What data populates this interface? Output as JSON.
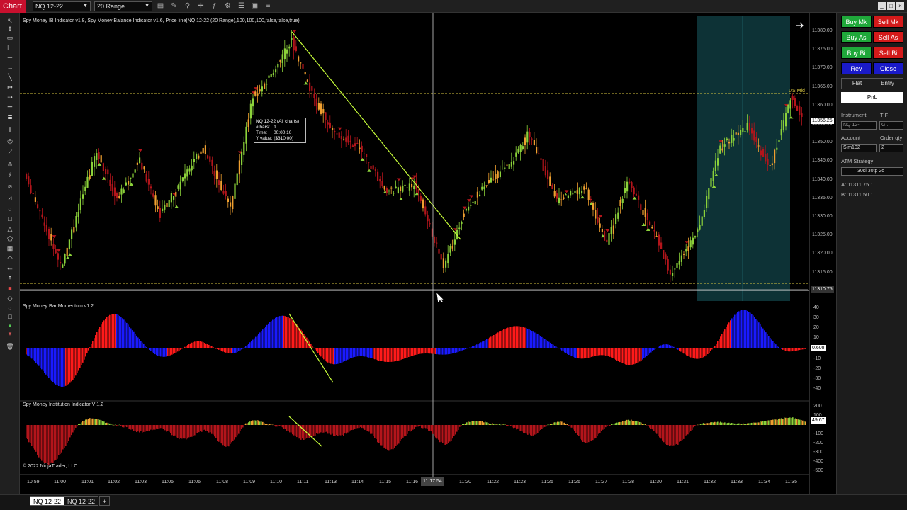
{
  "titlebar": {
    "chart_tab": "Chart",
    "instrument": "NQ 12-22",
    "bar_type": "20 Range"
  },
  "chart": {
    "price_pane_label": "Spy Money IB Indicator v1.8, Spy Money Balance Indicator v1.6, Price line(NQ 12-22 (20 Range),100,100,100,false,false,true)",
    "momentum_pane_label": "Spy Money Bar Momentum v1.2",
    "institution_pane_label": "Spy Money Institution Indicator V 1.2",
    "copyright": "© 2022 NinjaTrader, LLC",
    "us_mid_label": "US Mid",
    "price_axis": [
      "11380.00",
      "11375.00",
      "11370.00",
      "11365.00",
      "11360.00",
      "11355.00",
      "11350.00",
      "11345.00",
      "11340.00",
      "11335.00",
      "11330.00",
      "11325.00",
      "11320.00",
      "11315.00"
    ],
    "price_markers": {
      "current": "11356.25",
      "cursor": "11310.75"
    },
    "momentum_axis": [
      "40",
      "30",
      "20",
      "10",
      "-10",
      "-20",
      "-30",
      "-40"
    ],
    "momentum_marker": "0.608",
    "institution_axis": [
      "200",
      "100",
      "-100",
      "-200",
      "-300",
      "-400",
      "-500"
    ],
    "institution_marker": "49.67",
    "time_axis": [
      "10:59",
      "11:00",
      "11:01",
      "11:02",
      "11:03",
      "11:05",
      "11:06",
      "11:08",
      "11:09",
      "11:10",
      "11:11",
      "11:13",
      "11:14",
      "11:15",
      "11:16",
      "11:20",
      "11:22",
      "11:23",
      "11:25",
      "11:26",
      "11:27",
      "11:28",
      "11:30",
      "11:31",
      "11:32",
      "11:33",
      "11:34",
      "11:35"
    ],
    "time_cursor": "11:17:54",
    "tooltip": {
      "title": "NQ 12-22 (All charts)",
      "bars_label": "# bars:",
      "bars_value": "1",
      "time_label": "Time:",
      "time_value": "00:00:10",
      "yvalue_label": "Y value:",
      "yvalue_value": "($310.00)"
    }
  },
  "chart_data": {
    "type": "bar",
    "title": "",
    "xlabel": "",
    "ylabel": "",
    "ylim": [
      11312,
      11382
    ],
    "us_mid_level": 11364.5,
    "cursor_price": 11310.75,
    "current_price": 11356.25,
    "series": []
  },
  "rightpanel": {
    "buy_mkt": "Buy Mk",
    "sell_mkt": "Sell Mk",
    "buy_ask": "Buy As",
    "sell_ask": "Sell As",
    "buy_bid": "Buy Bi",
    "sell_bid": "Sell Bi",
    "rev": "Rev",
    "close": "Close",
    "flat": "Flat",
    "entry": "Entry",
    "pnl": "PnL",
    "instrument_label": "Instrument",
    "tif_label": "TIF",
    "instrument_value": "NQ 12-",
    "tif_value": "G...",
    "account_label": "Account",
    "order_qty_label": "Order qty",
    "account_value": "Sim102",
    "order_qty_value": "2",
    "atm_label": "ATM Strategy",
    "atm_value": "30sl 30tp 2c",
    "ask_line": "A:  11311.75   1",
    "bid_line": "B:  11311.50   1"
  },
  "bottombar": {
    "tab1": "NQ 12-22",
    "tab2": "NQ 12-22",
    "add": "+"
  },
  "colors": {
    "up": "#8bd13a",
    "down": "#b3151b",
    "orange": "#f0a030",
    "momentum_up": "#1a1aff",
    "momentum_down": "#ff1a1a",
    "ib_zone": "#0f3b3f",
    "us_mid": "#d8c640"
  }
}
